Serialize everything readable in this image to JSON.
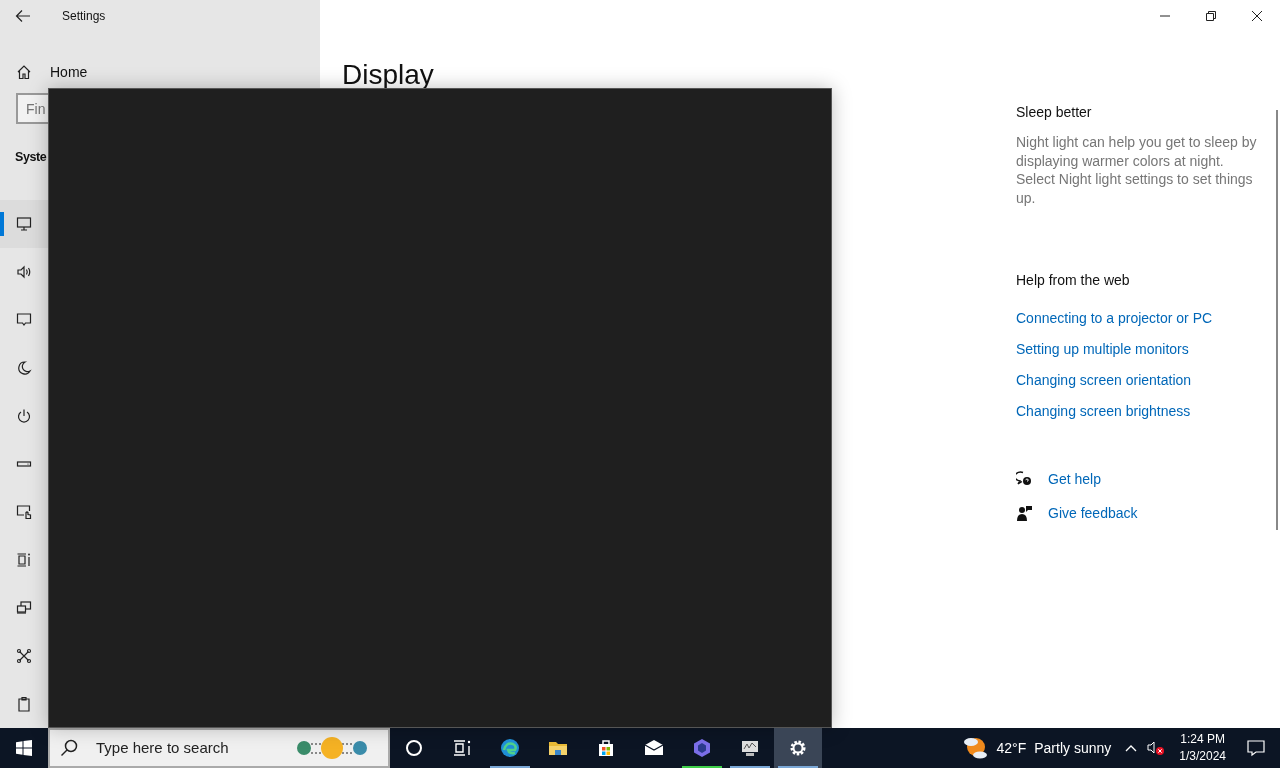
{
  "window": {
    "title": "Settings"
  },
  "sidebar": {
    "home": "Home",
    "search": {
      "placeholder": "Fin"
    },
    "section": "Syste",
    "items": [
      {
        "selected": true
      },
      {
        "selected": false
      },
      {
        "selected": false
      },
      {
        "selected": false
      },
      {
        "selected": false
      },
      {
        "selected": false
      },
      {
        "selected": false
      },
      {
        "selected": false
      },
      {
        "selected": false
      },
      {
        "selected": false
      },
      {
        "selected": false
      }
    ]
  },
  "page": {
    "title": "Display"
  },
  "aside": {
    "sleep": {
      "heading": "Sleep better",
      "text": "Night light can help you get to sleep by displaying warmer colors at night. Select Night light settings to set things up."
    },
    "help": {
      "heading": "Help from the web",
      "links": [
        "Connecting to a projector or PC",
        "Setting up multiple monitors",
        "Changing screen orientation",
        "Changing screen brightness"
      ]
    },
    "actions": [
      {
        "kind": "help",
        "label": "Get help"
      },
      {
        "kind": "feedback",
        "label": "Give feedback"
      }
    ]
  },
  "taskbar": {
    "search": {
      "placeholder": "Type here to search"
    },
    "apps": [
      {
        "running": false,
        "active": false
      },
      {
        "running": false,
        "active": false
      },
      {
        "running": true,
        "active": false
      },
      {
        "running": false,
        "active": false
      },
      {
        "running": false,
        "active": false
      },
      {
        "running": false,
        "active": false
      },
      {
        "running": true,
        "active": false
      },
      {
        "running": true,
        "active": false
      },
      {
        "running": true,
        "active": true
      }
    ],
    "weather": {
      "temperature": "42°F",
      "condition": "Partly sunny"
    },
    "clock": {
      "time": "1:24 PM",
      "date": "1/3/2024"
    }
  }
}
